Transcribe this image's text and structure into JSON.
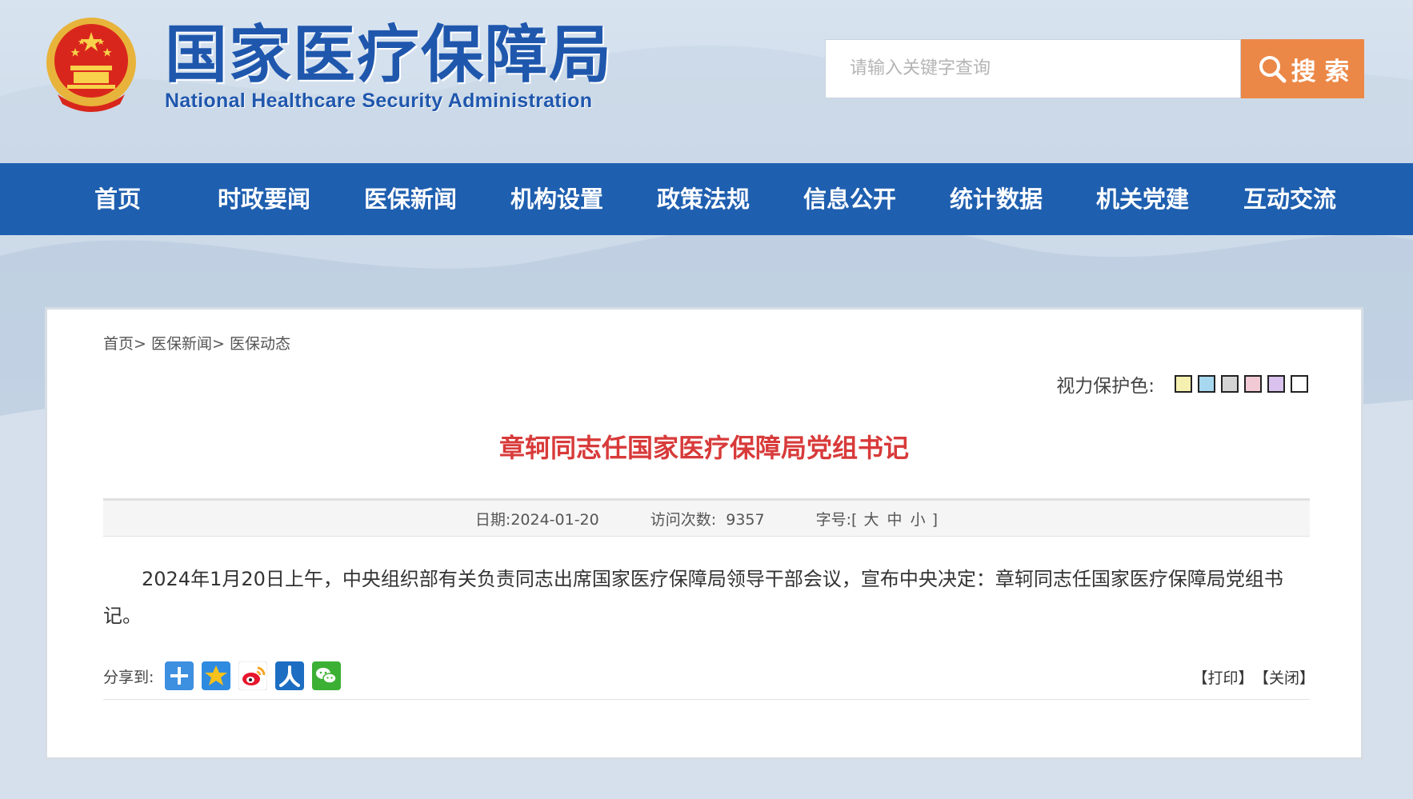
{
  "header": {
    "logo_cn": "国家医疗保障局",
    "logo_en": "National Healthcare Security Administration",
    "emblem_icon": "national-emblem-icon"
  },
  "search": {
    "placeholder": "请输入关键字查询",
    "button_label": "搜 索",
    "icon": "search-icon",
    "button_color": "#ec8847"
  },
  "nav": {
    "items": [
      "首页",
      "时政要闻",
      "医保新闻",
      "机构设置",
      "政策法规",
      "信息公开",
      "统计数据",
      "机关党建",
      "互动交流"
    ],
    "background": "#1f5faf"
  },
  "breadcrumb": {
    "home": "首页",
    "sep1": ">",
    "level1": "医保新闻",
    "sep2": ">",
    "level2": "医保动态"
  },
  "vision": {
    "label": "视力保护色:",
    "swatches": [
      "#f5f0b0",
      "#a8d8ef",
      "#d4d4d4",
      "#f2cad6",
      "#d9c2ee",
      "#ffffff"
    ]
  },
  "article": {
    "title": "章轲同志任国家医疗保障局党组书记",
    "title_color": "#d83a3a",
    "date_label": "日期:",
    "date": "2024-01-20",
    "views_label": "访问次数:",
    "views": "9357",
    "font_label": "字号:",
    "font_open": "[",
    "font_large": "大",
    "font_medium": "中",
    "font_small": "小",
    "font_close": "]",
    "body": "2024年1月20日上午，中央组织部有关负责同志出席国家医疗保障局领导干部会议，宣布中央决定：章轲同志任国家医疗保障局党组书记。"
  },
  "share": {
    "label": "分享到:",
    "icons": [
      "plus-share-icon",
      "qzone-star-icon",
      "weibo-icon",
      "renren-icon",
      "wechat-icon"
    ]
  },
  "actions": {
    "print": "【打印】",
    "close": "【关闭】"
  }
}
